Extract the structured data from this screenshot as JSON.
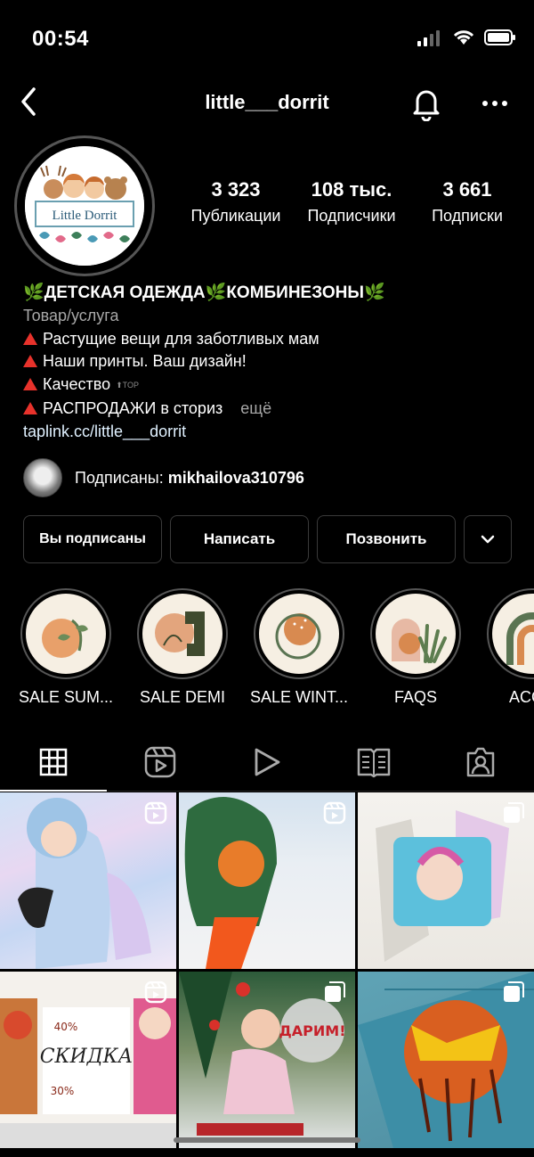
{
  "status_bar": {
    "time": "00:54"
  },
  "header": {
    "username": "little___dorrit"
  },
  "profile": {
    "logo_text": "Little Dorrit",
    "stats": [
      {
        "value": "3 323",
        "label": "Публикации"
      },
      {
        "value": "108 тыс.",
        "label": "Подписчики"
      },
      {
        "value": "3 661",
        "label": "Подписки"
      }
    ]
  },
  "bio": {
    "title": "ДЕТСКАЯ ОДЕЖДА",
    "title_2": "КОМБИНЕЗОНЫ",
    "category": "Товар/услуга",
    "lines": [
      "Растущие вещи для заботливых мам",
      "Наши принты. Ваш дизайн!",
      "Качество",
      "РАСПРОДАЖИ в сториз"
    ],
    "top_badge": "TOP",
    "more": "ещё",
    "link": "taplink.cc/little___dorrit"
  },
  "followed_by": {
    "prefix": "Подписаны: ",
    "user": "mikhailova310796"
  },
  "buttons": {
    "subscribed": "Вы подписаны",
    "message": "Написать",
    "call": "Позвонить"
  },
  "highlights": [
    {
      "label": "SALE SUM..."
    },
    {
      "label": "SALE DEMI"
    },
    {
      "label": "SALE WINT..."
    },
    {
      "label": "FAQS"
    },
    {
      "label": "ACCO"
    }
  ],
  "posts": {
    "sale_word": "СКИДКА",
    "percent_40": "40%",
    "percent_30": "30%",
    "gift_text": "ДАРИМ!"
  },
  "colors": {
    "background": "#000000",
    "accent_red": "#e8322b",
    "leaf_green": "#6fbf4a"
  }
}
